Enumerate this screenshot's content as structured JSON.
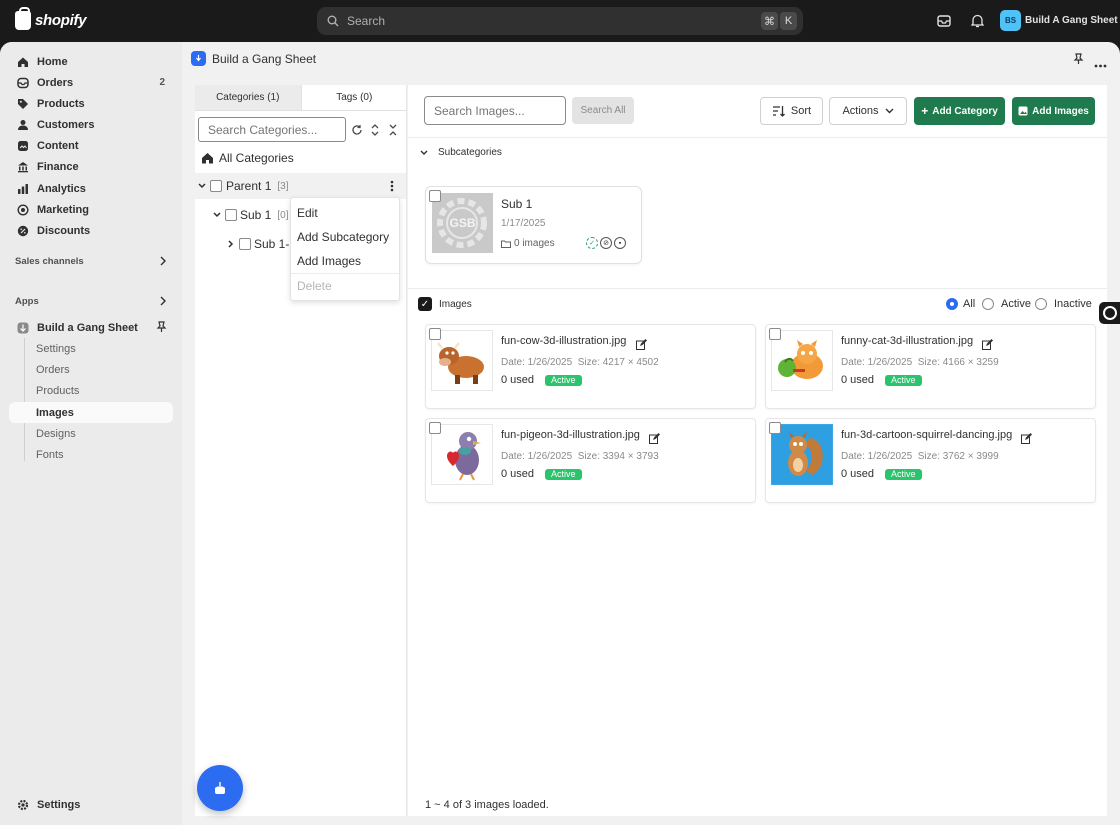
{
  "topbar": {
    "brand": "shopify",
    "search_placeholder": "Search",
    "shortcut_cmd": "⌘",
    "shortcut_key": "K",
    "store_initials": "BS",
    "store_name": "Build A Gang Sheet"
  },
  "nav": {
    "items": [
      {
        "label": "Home",
        "icon": "home-icon"
      },
      {
        "label": "Orders",
        "icon": "orders-icon",
        "badge": "2"
      },
      {
        "label": "Products",
        "icon": "tag-icon"
      },
      {
        "label": "Customers",
        "icon": "person-icon"
      },
      {
        "label": "Content",
        "icon": "content-icon"
      },
      {
        "label": "Finance",
        "icon": "bank-icon"
      },
      {
        "label": "Analytics",
        "icon": "chart-icon"
      },
      {
        "label": "Marketing",
        "icon": "target-icon"
      },
      {
        "label": "Discounts",
        "icon": "discount-icon"
      }
    ],
    "sales_channels": "Sales channels",
    "apps": "Apps",
    "app_name": "Build a Gang Sheet",
    "app_sub": [
      "Settings",
      "Orders",
      "Products",
      "Images",
      "Designs",
      "Fonts"
    ],
    "settings": "Settings"
  },
  "appbar": {
    "title": "Build a Gang Sheet"
  },
  "categories": {
    "tab_categories": "Categories (1)",
    "tab_tags": "Tags (0)",
    "search_placeholder": "Search Categories...",
    "all": "All Categories",
    "parent": {
      "name": "Parent 1",
      "count": "[3]"
    },
    "sub": {
      "name": "Sub 1",
      "count": "[0]"
    },
    "subsub": {
      "name": "Sub 1-1"
    }
  },
  "context_menu": {
    "edit": "Edit",
    "add_sub": "Add Subcategory",
    "add_images": "Add Images",
    "delete": "Delete"
  },
  "toolbar": {
    "search_placeholder": "Search Images...",
    "search_all": "Search All",
    "sort": "Sort",
    "actions": "Actions",
    "add_category": "Add Category",
    "add_images": "Add Images"
  },
  "subcategories": {
    "header": "Subcategories",
    "card": {
      "thumb_text": "GSB",
      "name": "Sub 1",
      "date": "1/17/2025",
      "images": "0 images"
    }
  },
  "images_section": {
    "header": "Images",
    "filter_all": "All",
    "filter_active": "Active",
    "filter_inactive": "Inactive",
    "items": [
      {
        "name": "fun-cow-3d-illustration.jpg",
        "date": "Date: 1/26/2025",
        "size": "Size: 4217 × 4502",
        "used": "0 used",
        "status": "Active"
      },
      {
        "name": "funny-cat-3d-illustration.jpg",
        "date": "Date: 1/26/2025",
        "size": "Size: 4166 × 3259",
        "used": "0 used",
        "status": "Active"
      },
      {
        "name": "fun-pigeon-3d-illustration.jpg",
        "date": "Date: 1/26/2025",
        "size": "Size: 3394 × 3793",
        "used": "0 used",
        "status": "Active"
      },
      {
        "name": "fun-3d-cartoon-squirrel-dancing.jpg",
        "date": "Date: 1/26/2025",
        "size": "Size: 3762 × 3999",
        "used": "0 used",
        "status": "Active"
      }
    ],
    "loaded": "1 ~ 4 of 3 images loaded."
  }
}
